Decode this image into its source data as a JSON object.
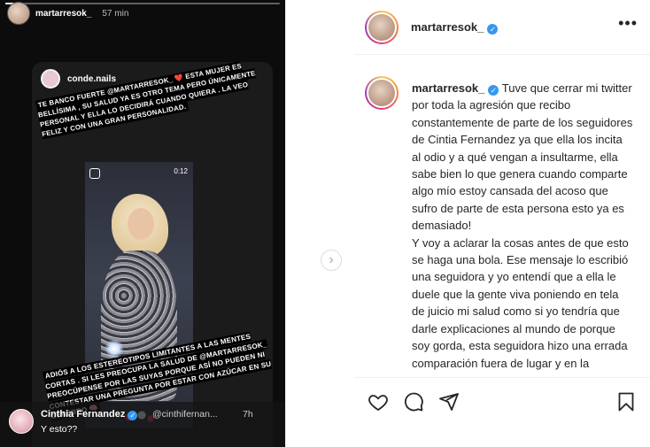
{
  "story": {
    "username": "martarresok_",
    "time_ago": "57 min",
    "progress": 0.04,
    "shared_post": {
      "username": "conde.nails",
      "caption_top": "TE BANCO FUERTE @MARTARRESOK_ ❤️ ESTA MUJER ES BELLÍSIMA , SU SALUD YA ES OTRO TEMA PERO ÚNICAMENTE PERSONAL Y ELLA LO DECIDIRÁ CUANDO QUIERA . LA VEO FELIZ Y CON UNA GRAN PERSONALIDAD.",
      "video_time": "0:12",
      "caption_bottom": "ADIÓS A LOS ESTEREOTIPOS LIMITANTES A LAS MENTES CORTAS . SI LES PREOCUPA LA SALUD DE @MARTARRESOK_ PREOCÚPENSE POR LAS SUYAS PORQUE ASÍ NO PUEDEN NI CONTESTAR UNA PREGUNTA POR ESTAR CON AZÚCAR EN SU CEREBRO 🧠"
    },
    "reply": {
      "name": "Cinthia Fernandez",
      "handle": "@cinthifernan...",
      "time": "7h",
      "text": "Y esto??"
    }
  },
  "post": {
    "username": "martarresok_",
    "more_icon": "more-horizontal-icon",
    "caption_username": "martarresok_",
    "caption": "Tuve que cerrar mi twitter por toda la agresión que recibo constantemente de parte de los seguidores de Cintia Fernandez ya que ella los incita al odio y a qué vengan a insultarme, ella sabe bien lo que genera cuando comparte algo mío estoy cansada del acoso que sufro de parte de esta persona esto ya es demasiado!",
    "caption_cont": "Y voy a aclarar la cosas antes de que esto se haga una bola. Ese mensaje lo escribió una seguidora y yo entendí que a ella le duele que la gente viva poniendo en tela de juicio mi salud como si yo tendría que darle explicaciones al mundo de porque soy gorda, esta seguidora hizo una errada comparación fuera de lugar y en la",
    "next_icon": "chevron-right-icon",
    "actions": {
      "like": "heart-icon",
      "comment": "comment-icon",
      "share": "send-icon",
      "save": "bookmark-icon"
    }
  },
  "colors": {
    "verified": "#3797f0",
    "text": "#262626",
    "border": "#efefef"
  }
}
